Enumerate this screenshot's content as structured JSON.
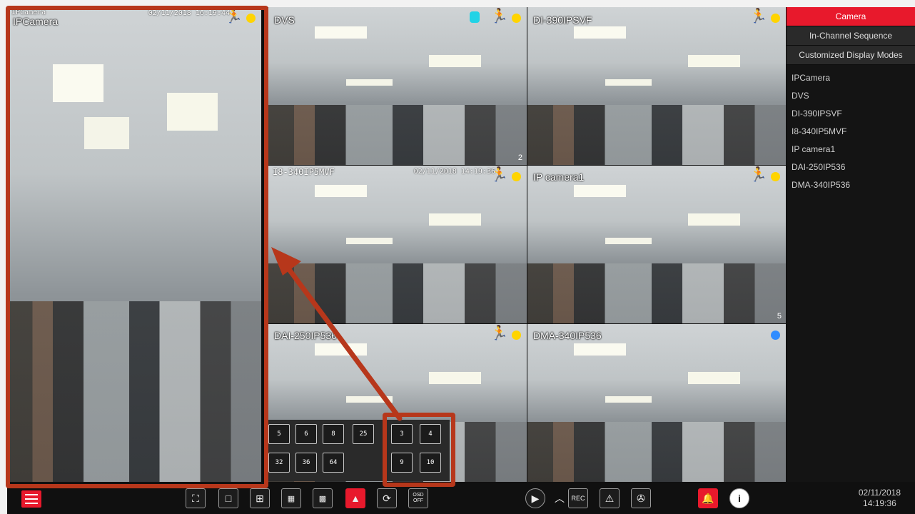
{
  "cameras": [
    {
      "name": "IPCamera",
      "osd": "IPCamera",
      "timestamp": "02/11/2018 16:19:44",
      "tile_number": "",
      "dot": "yellow",
      "motion": true,
      "face": false
    },
    {
      "name": "DVS",
      "osd": "DVS",
      "timestamp": "",
      "tile_number": "2",
      "dot": "yellow",
      "motion": true,
      "face": true
    },
    {
      "name": "DI-390IPSVF",
      "osd": "",
      "timestamp": "",
      "tile_number": "",
      "dot": "yellow",
      "motion": true,
      "face": false
    },
    {
      "name": "I8-340IP5MVF",
      "osd": "I8-340IP5MVF",
      "timestamp": "02/11/2018 14:19:36",
      "tile_number": "",
      "dot": "yellow",
      "motion": true,
      "face": false
    },
    {
      "name": "IP camera1",
      "osd": "",
      "timestamp": "",
      "tile_number": "5",
      "dot": "yellow",
      "motion": true,
      "face": false
    },
    {
      "name": "DAI-250IP536",
      "osd": "",
      "timestamp": "",
      "tile_number": "",
      "dot": "yellow",
      "motion": true,
      "face": false
    },
    {
      "name": "DMA-340IP536",
      "osd": "",
      "timestamp": "",
      "tile_number": "",
      "dot": "blue",
      "motion": false,
      "face": false
    }
  ],
  "side_panel": {
    "buttons": [
      "Camera",
      "In-Channel Sequence",
      "Customized Display Modes"
    ],
    "active": "Camera",
    "camera_list": [
      "IPCamera",
      "DVS",
      "DI-390IPSVF",
      "I8-340IP5MVF",
      "IP camera1",
      "DAI-250IP536",
      "DMA-340IP536"
    ]
  },
  "layout_popup": {
    "row1": [
      "5",
      "6",
      "8",
      "25"
    ],
    "row2": [
      "32",
      "36",
      "64"
    ],
    "highlighted": [
      "3",
      "4",
      "9",
      "10"
    ]
  },
  "toolbar": {
    "left_icons": [
      "menu-icon"
    ],
    "layout_icons": [
      "fullscreen-icon",
      "layout-1-icon",
      "layout-4-icon",
      "layout-9-icon",
      "layout-16-icon",
      "layout-custom-icon",
      "sequence-icon"
    ],
    "osd_label": "OSD OFF",
    "right_icons": [
      "playback-icon",
      "expand-up-icon",
      "record-icon",
      "manual-alarm-icon",
      "disk-icon",
      "alarm-bell-icon",
      "info-icon"
    ]
  },
  "clock": {
    "date": "02/11/2018",
    "time": "14:19:36"
  },
  "colors": {
    "accent": "#e8192c",
    "annotation": "#b7371b",
    "status_yellow": "#ffd400",
    "status_blue": "#2f8cff"
  }
}
